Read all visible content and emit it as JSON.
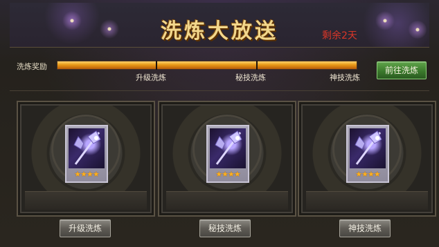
{
  "header": {
    "title": "洗炼大放送",
    "days_remaining": "剩余2天"
  },
  "progress": {
    "label": "洗炼奖励",
    "fill_fraction": 1.0,
    "milestones": [
      "升级洗炼",
      "秘技洗炼",
      "神技洗炼"
    ]
  },
  "goto_button": {
    "label": "前往洗炼"
  },
  "cards": [
    {
      "button_label": "升级洗炼",
      "stars": "★★★★",
      "icon": "polearm-weapon-icon"
    },
    {
      "button_label": "秘技洗炼",
      "stars": "★★★★",
      "icon": "polearm-weapon-icon"
    },
    {
      "button_label": "神技洗炼",
      "stars": "★★★★",
      "icon": "polearm-weapon-icon"
    }
  ],
  "colors": {
    "title_gold": "#f2d78c",
    "days_red": "#d93628",
    "progress_orange": "#e89a18",
    "goto_green": "#3b7a2c",
    "star_gold": "#ffb020"
  }
}
